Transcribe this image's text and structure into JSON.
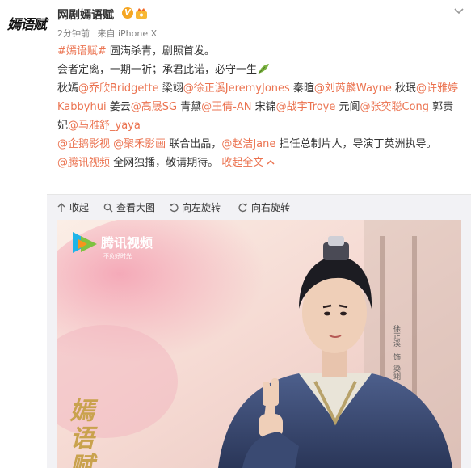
{
  "header": {
    "avatar_text": "嫣语赋",
    "author": "网剧嫣语赋",
    "time": "2分钟前",
    "source": "来自 iPhone X"
  },
  "post": {
    "hashtag": "#嫣语赋#",
    "line1_text": " 圆满杀青，剧照首发。",
    "line2_text": "会者定离，一期一祈；承君此诺，必守一生",
    "roles": [
      {
        "role": "秋嫣",
        "mention": "@乔欣Bridgette"
      },
      {
        "role": " 梁翊",
        "mention": "@徐正溪JeremyJones"
      },
      {
        "role": " 秦暄",
        "mention": "@刘芮麟Wayne"
      },
      {
        "role": " 秋珉",
        "mention": "@许雅婷Kabbyhui"
      },
      {
        "role": " 姜云",
        "mention": "@高晟SG"
      },
      {
        "role": " 青黛",
        "mention": "@王倩-AN"
      },
      {
        "role": " 宋锦",
        "mention": "@战宇Troye"
      },
      {
        "role": " 元阆",
        "mention": "@张奕聪Cong"
      },
      {
        "role": " 郭贵妃",
        "mention": "@马雅舒_yaya"
      }
    ],
    "producer1": "@企鹅影视",
    "producer2": "@聚禾影画",
    "joint": " 联合出品，",
    "chief_producer": "@赵洁Jane",
    "chief_text": " 担任总制片人，导演丁英洲执导。",
    "platform": "@腾讯视频",
    "platform_text": " 全网独播，敬请期待。",
    "collapse": "收起全文"
  },
  "toolbar": {
    "collapse": "收起",
    "view_large": "查看大图",
    "rotate_left": "向左旋转",
    "rotate_right": "向右旋转"
  },
  "poster": {
    "brand_cn": "腾讯视频",
    "brand_slogan": "不负好时光",
    "title": "嫣语赋",
    "side_text1": "徐正溪",
    "side_text2": "饰",
    "side_text3": "梁翊"
  },
  "colors": {
    "link": "#eb7350",
    "toolbar_bg": "#f2f2f5",
    "verified": "#f5a623"
  }
}
